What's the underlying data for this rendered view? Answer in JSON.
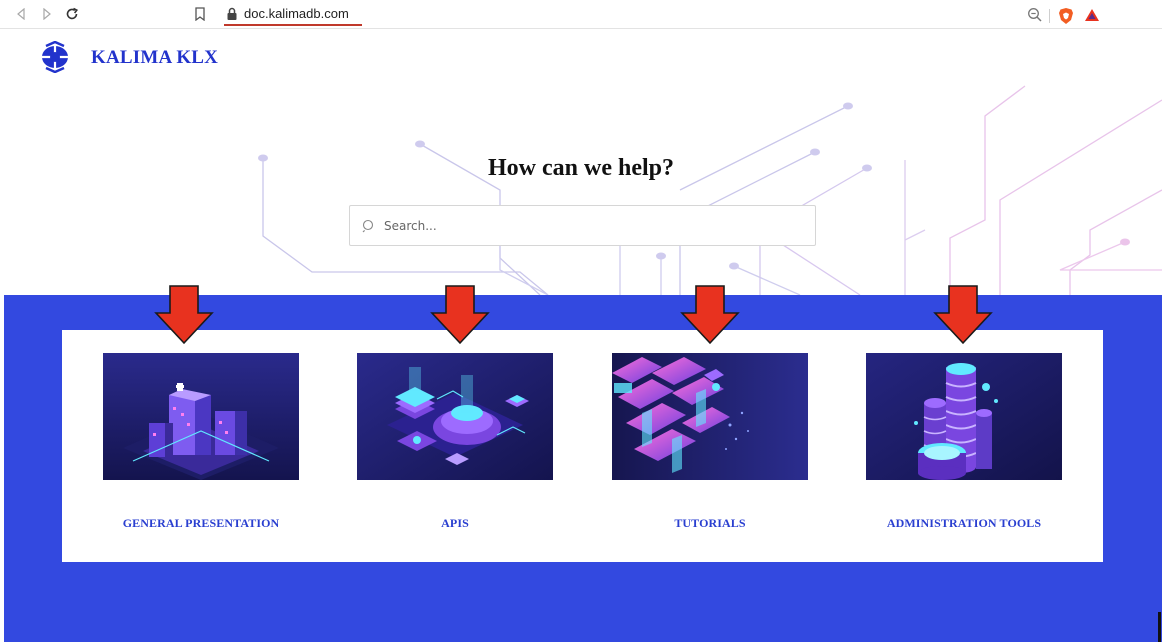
{
  "browser": {
    "url": "doc.kalimadb.com",
    "icons": [
      "back-icon",
      "forward-icon",
      "reload-icon",
      "bookmark-icon",
      "lock-icon",
      "zoom-icon",
      "brave-shield-icon",
      "bat-rewards-icon"
    ]
  },
  "site": {
    "name": "KALIMA KLX",
    "logo": "kalima-logo-icon",
    "brand_color": "#2233cc"
  },
  "hero": {
    "title": "How can we help?",
    "search_placeholder": "Search..."
  },
  "band_color": "#3349e0",
  "arrow_color": "#e8321f",
  "tiles": [
    {
      "label": "GENERAL PRESENTATION",
      "image": "isometric-city-illustration"
    },
    {
      "label": "APIS",
      "image": "isometric-platform-illustration"
    },
    {
      "label": "TUTORIALS",
      "image": "isometric-blocks-illustration"
    },
    {
      "label": "ADMINISTRATION TOOLS",
      "image": "isometric-database-stack-illustration"
    }
  ]
}
